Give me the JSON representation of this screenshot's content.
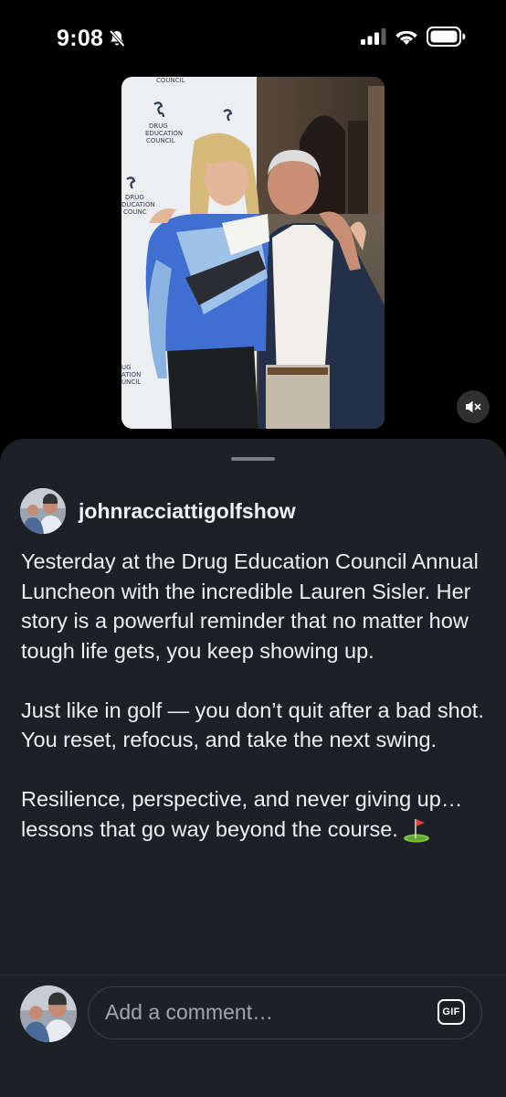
{
  "status_bar": {
    "time": "9:08"
  },
  "post": {
    "username": "johnracciattigolfshow",
    "caption": [
      "Yesterday at the Drug Education Council Annual Luncheon with the incredible Lauren Sisler. Her story is a powerful reminder that no matter how tough life gets, you keep showing up.",
      "Just like in golf — you don’t quit after a bad shot. You reset, refocus, and take the next swing.",
      "Resilience, perspective, and never giving up… lessons that go way beyond the course."
    ],
    "backdrop_logo_text": [
      "DRUG",
      "EDUCATION",
      "COUNCIL"
    ]
  },
  "comment_bar": {
    "placeholder": "Add a comment…",
    "gif_label": "GIF"
  },
  "icons": [
    "bell-slash-icon",
    "signal-icon",
    "wifi-icon",
    "battery-icon",
    "mute-icon",
    "golf-flag-emoji"
  ],
  "colors": {
    "sheet_bg": "#1d2025",
    "page_bg": "#000000"
  }
}
